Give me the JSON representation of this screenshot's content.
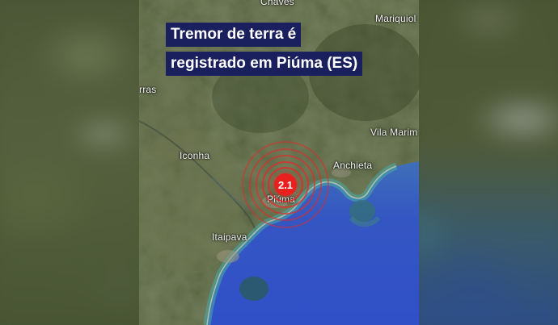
{
  "headline": {
    "line1": "Tremor de terra é",
    "line2": "registrado em Piúma (ES)"
  },
  "places": {
    "chaves": "Chaves",
    "mariquiol": "Mariquiol",
    "rras": "rras",
    "vila_marim": "Vila Marim",
    "iconha": "Iconha",
    "anchieta": "Anchieta",
    "piuma": "Piúma",
    "itaipava": "Itaipava"
  },
  "quake": {
    "magnitude": "2.1",
    "color": "#e8201e"
  },
  "colors": {
    "ocean": "#3458c8",
    "land": "#4d5a36",
    "headline_bg": "#1a1f5e"
  }
}
